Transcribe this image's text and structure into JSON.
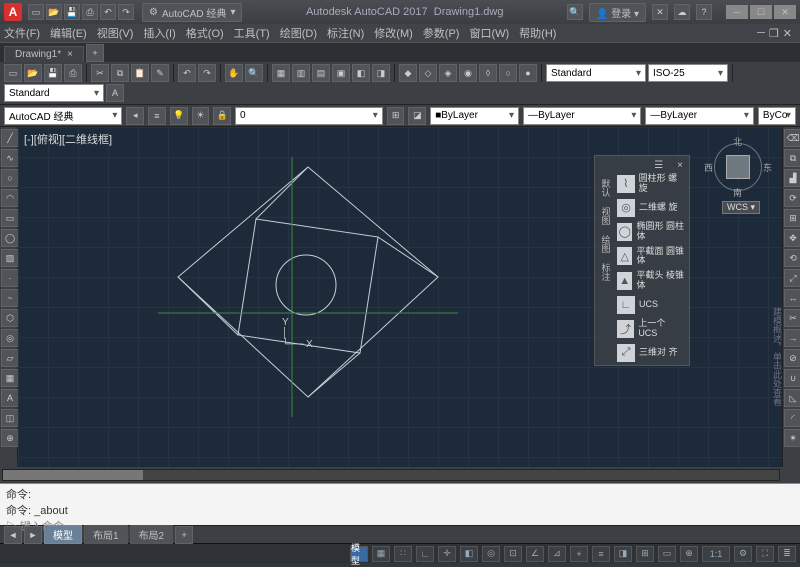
{
  "title": {
    "app": "Autodesk AutoCAD 2017",
    "file": "Drawing1.dwg"
  },
  "logo": "A",
  "workspace_pill": "AutoCAD 经典",
  "login": "登录",
  "menubar": [
    "文件(F)",
    "编辑(E)",
    "视图(V)",
    "插入(I)",
    "格式(O)",
    "工具(T)",
    "绘图(D)",
    "标注(N)",
    "修改(M)",
    "参数(P)",
    "窗口(W)",
    "帮助(H)"
  ],
  "doc_tab": {
    "label": "Drawing1*",
    "close": "×"
  },
  "propbar": {
    "workspace": "AutoCAD 经典",
    "opacity": "0",
    "dim_style": "Standard",
    "iso": "ISO-25",
    "text_style": "Standard",
    "linetype": "ByLayer",
    "lineweight": "ByLayer",
    "color": "ByCo"
  },
  "view_label": "[-][俯视][二维线框]",
  "navcube": {
    "n": "北",
    "s": "南",
    "e": "东",
    "w": "西"
  },
  "wcs": "WCS ▾",
  "ucs": {
    "x": "X",
    "y": "Y"
  },
  "panel3d": {
    "tabs": [
      "默认",
      "视图",
      "绘图",
      "标注"
    ],
    "items": [
      {
        "icon": "⌇",
        "label": "圆柱形\n螺旋"
      },
      {
        "icon": "◎",
        "label": "二维螺\n旋"
      },
      {
        "icon": "◯",
        "label": "椭圆形\n圆柱体"
      },
      {
        "icon": "△",
        "label": "平截面\n圆锥体"
      },
      {
        "icon": "▲",
        "label": "平截头\n棱锥体"
      },
      {
        "icon": "∟",
        "label": "UCS"
      },
      {
        "icon": "⤴",
        "label": "上一个\nUCS"
      },
      {
        "icon": "⤢",
        "label": "三维对\n齐"
      }
    ],
    "close": "×",
    "menu": "☰"
  },
  "hint_vertical": "建模概述，单击此处查看",
  "cmd": {
    "line1": "命令:",
    "line2_label": "命令:",
    "line2_val": "_about",
    "prompt": "▷ 键入命令"
  },
  "layout_tabs": {
    "nav": [
      "◄",
      "►",
      "+"
    ],
    "items": [
      "模型",
      "布局1",
      "布局2"
    ]
  },
  "status": {
    "mode": "模型",
    "scale": "1:1"
  }
}
